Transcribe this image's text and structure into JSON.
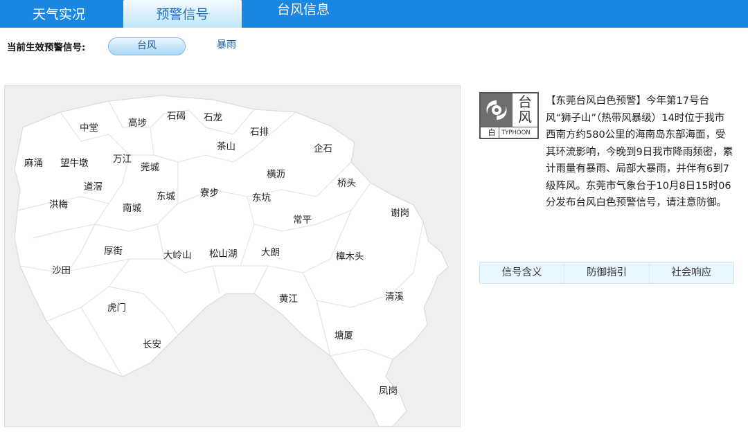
{
  "tabs": {
    "weather": "天气实况",
    "warning": "预警信号",
    "typhoon": "台风信息"
  },
  "active_signals": {
    "label": "当前生效预警信号:",
    "typhoon": "台风",
    "rainstorm": "暴雨"
  },
  "map": {
    "places": [
      "中堂",
      "高埗",
      "石碣",
      "石龙",
      "石排",
      "茶山",
      "企石",
      "麻涌",
      "望牛墩",
      "万江",
      "莞城",
      "横沥",
      "桥头",
      "道滘",
      "东城",
      "寮步",
      "东坑",
      "洪梅",
      "南城",
      "常平",
      "谢岗",
      "厚街",
      "大岭山",
      "松山湖",
      "大朗",
      "樟木头",
      "沙田",
      "黄江",
      "清溪",
      "虎门",
      "塘厦",
      "长安",
      "凤岗"
    ]
  },
  "warning": {
    "icon_char_top": "台",
    "icon_char_bottom": "风",
    "icon_level": "白",
    "icon_en": "TYPHOON",
    "text": "【东莞台风白色预警】今年第17号台风“狮子山”（热带风暴级）14时位于我市西南方约580公里的海南岛东部海面，受其环流影响，今晚到9日我市降雨频密，累计雨量有暴雨、局部大暴雨，并伴有6到7级阵风。东莞市气象台于10月8日15时06分发布台风白色预警信号，请注意防御。"
  },
  "info_tabs": [
    "信号含义",
    "防御指引",
    "社会响应"
  ],
  "colors": {
    "topbar": "#1a87e3",
    "map_bg": "#efefef",
    "region_fill": "#ffffff"
  }
}
